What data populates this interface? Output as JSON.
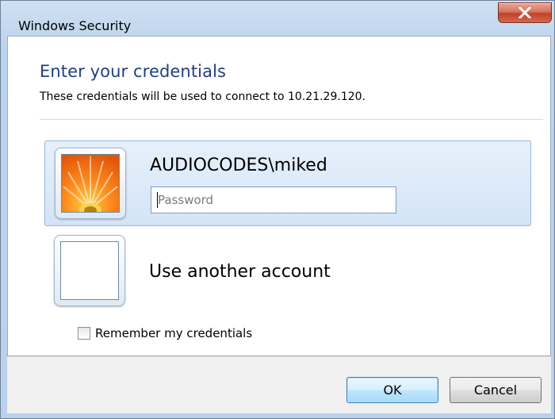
{
  "window": {
    "title": "Windows Security",
    "close_symbol": "X"
  },
  "main": {
    "heading": "Enter your credentials",
    "subheading": "These credentials will be used to connect to 10.21.29.120."
  },
  "accounts": [
    {
      "username": "AUDIOCODES\\miked",
      "avatar_icon": "flower-avatar-icon",
      "password_placeholder": "Password",
      "password_value": ""
    },
    {
      "label": "Use another account",
      "avatar_icon": "blank-avatar-icon"
    }
  ],
  "remember": {
    "label": "Remember my credentials",
    "checked": false
  },
  "buttons": {
    "ok": "OK",
    "cancel": "Cancel"
  },
  "colors": {
    "heading": "#1e3f8a",
    "selection": "#d3e4f7",
    "close_button": "#c0412a"
  }
}
